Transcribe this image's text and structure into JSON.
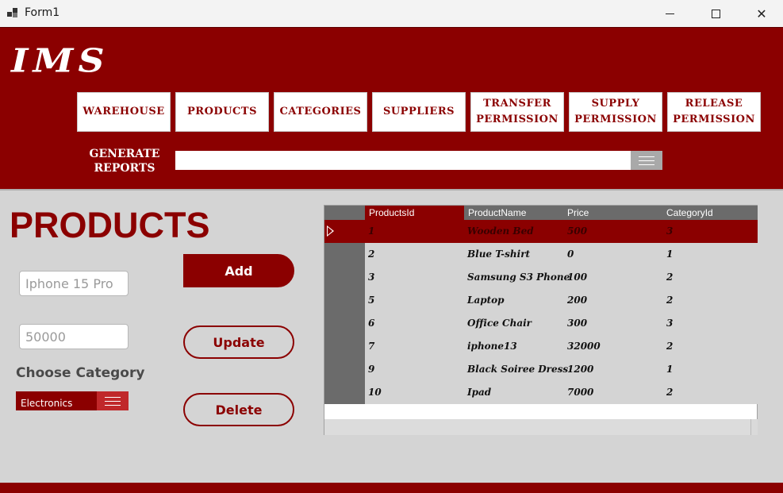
{
  "window": {
    "title": "Form1"
  },
  "header": {
    "logo": "IMS",
    "nav": [
      {
        "label": "WAREHOUSE"
      },
      {
        "label": "PRODUCTS"
      },
      {
        "label": "CATEGORIES"
      },
      {
        "label": "SUPPLIERS"
      },
      {
        "label": "TRANSFER\nPERMISSION"
      },
      {
        "label": "SUPPLY\nPERMISSION"
      },
      {
        "label": "RELEASE\nPERMISSION"
      }
    ],
    "generate_reports": "GENERATE\nREPORTS",
    "report_value": ""
  },
  "main": {
    "title": "PRODUCTS",
    "name_input": {
      "value": "Iphone 15 Pro"
    },
    "price_input": {
      "value": "50000"
    },
    "choose_category_label": "Choose Category",
    "category_value": "Electronics",
    "add_label": "Add",
    "update_label": "Update",
    "delete_label": "Delete"
  },
  "grid": {
    "columns": [
      "ProductsId",
      "ProductName",
      "Price",
      "CategoryId"
    ],
    "rows": [
      [
        "1",
        "Wooden Bed",
        "500",
        "3"
      ],
      [
        "2",
        "Blue T-shirt",
        "0",
        "1"
      ],
      [
        "3",
        "Samsung S3 Phone",
        "100",
        "2"
      ],
      [
        "5",
        "Laptop",
        "200",
        "2"
      ],
      [
        "6",
        "Office Chair",
        "300",
        "3"
      ],
      [
        "7",
        "iphone13",
        "32000",
        "2"
      ],
      [
        "9",
        "Black Soiree Dress",
        "1200",
        "1"
      ],
      [
        "10",
        "Ipad",
        "7000",
        "2"
      ]
    ],
    "selected_row": 0
  }
}
